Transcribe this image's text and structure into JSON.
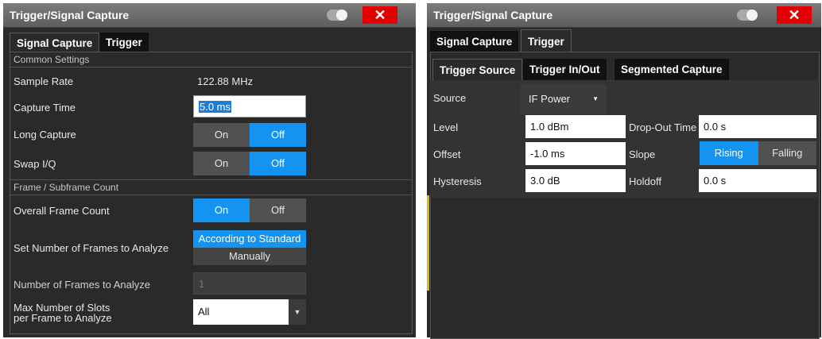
{
  "left": {
    "title": "Trigger/Signal Capture",
    "close": "✕",
    "tabs": [
      "Signal Capture",
      "Trigger"
    ],
    "common_settings": "Common Settings",
    "sample_rate_label": "Sample Rate",
    "sample_rate_value": "122.88 MHz",
    "capture_time_label": "Capture Time",
    "capture_time_value": "5.0 ms",
    "long_capture_label": "Long Capture",
    "swap_iq_label": "Swap I/Q",
    "on": "On",
    "off": "Off",
    "frame_section": "Frame / Subframe Count",
    "overall_frame_label": "Overall Frame Count",
    "set_number_label": "Set Number of Frames to Analyze",
    "according": "According to Standard",
    "manually": "Manually",
    "num_frames_label": "Number of Frames to Analyze",
    "num_frames_value": "1",
    "max_slots_label_1": "Max Number of Slots",
    "max_slots_label_2": "per Frame to Analyze",
    "max_slots_value": "All"
  },
  "right": {
    "title": "Trigger/Signal Capture",
    "close": "✕",
    "tabs": [
      "Signal Capture",
      "Trigger"
    ],
    "subtabs": [
      "Trigger Source",
      "Trigger In/Out",
      "Segmented Capture"
    ],
    "source_label": "Source",
    "source_value": "IF Power",
    "level_label": "Level",
    "level_value": "1.0 dBm",
    "dropout_label": "Drop-Out Time",
    "dropout_value": "0.0 s",
    "offset_label": "Offset",
    "offset_value": "-1.0 ms",
    "slope_label": "Slope",
    "rising": "Rising",
    "falling": "Falling",
    "hysteresis_label": "Hysteresis",
    "hysteresis_value": "3.0 dB",
    "holdoff_label": "Holdoff",
    "holdoff_value": "0.0 s"
  }
}
